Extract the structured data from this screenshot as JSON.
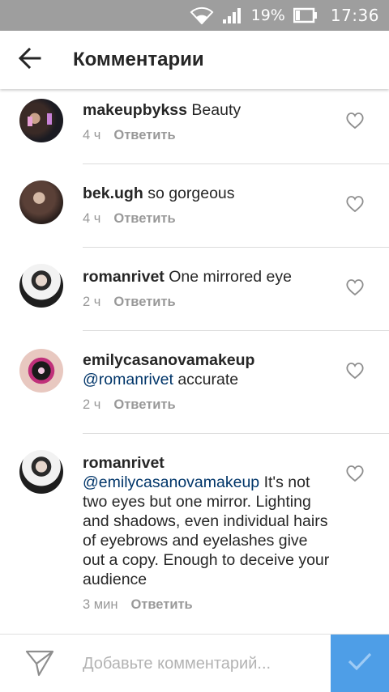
{
  "status_bar": {
    "battery_percent": "19%",
    "time": "17:36",
    "icons": [
      "wifi-icon",
      "signal-icon",
      "battery-icon"
    ],
    "background": "#9e9e9e"
  },
  "header": {
    "title": "Комментарии",
    "back_icon": "arrow-left-icon"
  },
  "comments": [
    {
      "username": "makeupbykss",
      "mention": "",
      "text": "Beauty",
      "time": "4 ч",
      "reply_label": "Ответить",
      "avatar": "avatar-makeupbykss"
    },
    {
      "username": "bek.ugh",
      "mention": "",
      "text": "so gorgeous",
      "time": "4 ч",
      "reply_label": "Ответить",
      "avatar": "avatar-bek-ugh"
    },
    {
      "username": "romanrivet",
      "mention": "",
      "text": "One mirrored eye",
      "time": "2 ч",
      "reply_label": "Ответить",
      "avatar": "avatar-romanrivet"
    },
    {
      "username": "emilycasanovamakeup",
      "mention": "@romanrivet",
      "text": "accurate",
      "time": "2 ч",
      "reply_label": "Ответить",
      "avatar": "avatar-emilycasanovamakeup"
    },
    {
      "username": "romanrivet",
      "mention": "@emilycasanovamakeup",
      "text": "It's not two eyes but one mirror. Lighting and shadows, even individual hairs of eyebrows and eyelashes give out a copy. Enough to deceive your audience",
      "time": "3 мин",
      "reply_label": "Ответить",
      "avatar": "avatar-romanrivet"
    }
  ],
  "composer": {
    "placeholder": "Добавьте комментарий...",
    "value": "",
    "send_icon": "paper-plane-icon",
    "post_icon": "checkmark-icon",
    "accent": "#4e9ee7"
  },
  "colors": {
    "mention": "#003569",
    "meta": "#999999",
    "divider": "#dbdbdb"
  }
}
